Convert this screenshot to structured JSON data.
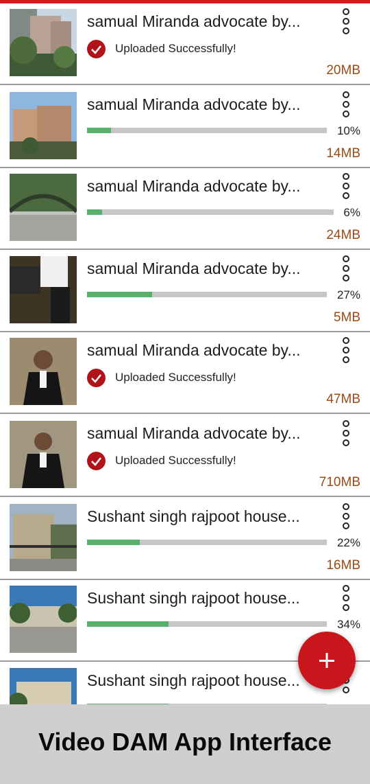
{
  "colors": {
    "accent": "#d41e1e",
    "progress": "#58b06a",
    "track": "#c6c6c6",
    "size_text": "#9a4a14",
    "success": "#b0141a"
  },
  "status_uploaded": "Uploaded Successfully!",
  "items": [
    {
      "title": "samual Miranda advocate by...",
      "state": "uploaded",
      "size": "20MB",
      "thumb": "buildings-tall"
    },
    {
      "title": "samual Miranda advocate by...",
      "state": "uploading",
      "progress": 10,
      "progress_label": "10%",
      "size": "14MB",
      "thumb": "buildings-street"
    },
    {
      "title": "samual Miranda advocate by...",
      "state": "uploading",
      "progress": 6,
      "progress_label": "6%",
      "size": "24MB",
      "thumb": "tree-arch"
    },
    {
      "title": "samual Miranda advocate by...",
      "state": "uploading",
      "progress": 27,
      "progress_label": "27%",
      "size": "5MB",
      "thumb": "person-suit-closeup"
    },
    {
      "title": "samual Miranda advocate by...",
      "state": "uploaded",
      "size": "47MB",
      "thumb": "person-sitting"
    },
    {
      "title": "samual Miranda advocate by...",
      "state": "uploaded",
      "size": "710MB",
      "thumb": "person-sitting-2"
    },
    {
      "title": "Sushant singh rajpoot house...",
      "state": "uploading",
      "progress": 22,
      "progress_label": "22%",
      "size": "16MB",
      "thumb": "house-gate"
    },
    {
      "title": "Sushant singh rajpoot house...",
      "state": "uploading",
      "progress": 34,
      "progress_label": "34%",
      "size": "",
      "thumb": "house-road"
    },
    {
      "title": "Sushant singh rajpoot house...",
      "state": "uploading",
      "progress": 34,
      "progress_label": "",
      "size": "",
      "thumb": "house-building"
    }
  ],
  "fab": {
    "icon": "plus-icon"
  },
  "banner": {
    "title": "Video DAM App Interface"
  }
}
